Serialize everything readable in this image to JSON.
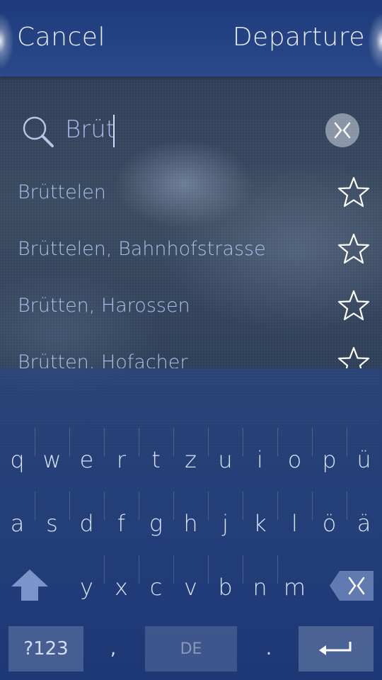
{
  "header": {
    "cancel_label": "Cancel",
    "title": "Departure"
  },
  "search": {
    "value": "Brüt",
    "icon": "search-icon",
    "clear_icon": "clear-icon"
  },
  "results": [
    {
      "label": "Brüttelen",
      "favorite": false
    },
    {
      "label": "Brüttelen, Bahnhofstrasse",
      "favorite": false
    },
    {
      "label": "Brütten, Harossen",
      "favorite": false
    },
    {
      "label": "Brütten, Hofacher",
      "favorite": false
    }
  ],
  "keyboard": {
    "row1": [
      "q",
      "w",
      "e",
      "r",
      "t",
      "z",
      "u",
      "i",
      "o",
      "p",
      "ü"
    ],
    "row2": [
      "a",
      "s",
      "d",
      "f",
      "g",
      "h",
      "j",
      "k",
      "l",
      "ö",
      "ä"
    ],
    "row3": [
      "y",
      "x",
      "c",
      "v",
      "b",
      "n",
      "m"
    ],
    "symbols_label": "?123",
    "comma": ",",
    "language": "DE",
    "period": ".",
    "enter_icon": "enter-icon",
    "shift_icon": "shift-icon",
    "backspace_icon": "backspace-icon"
  },
  "colors": {
    "header": "#1e3a7a",
    "result_text": "#a8c0ec",
    "search_text": "#a9b8e8",
    "key_text": "#dbe4fb"
  }
}
